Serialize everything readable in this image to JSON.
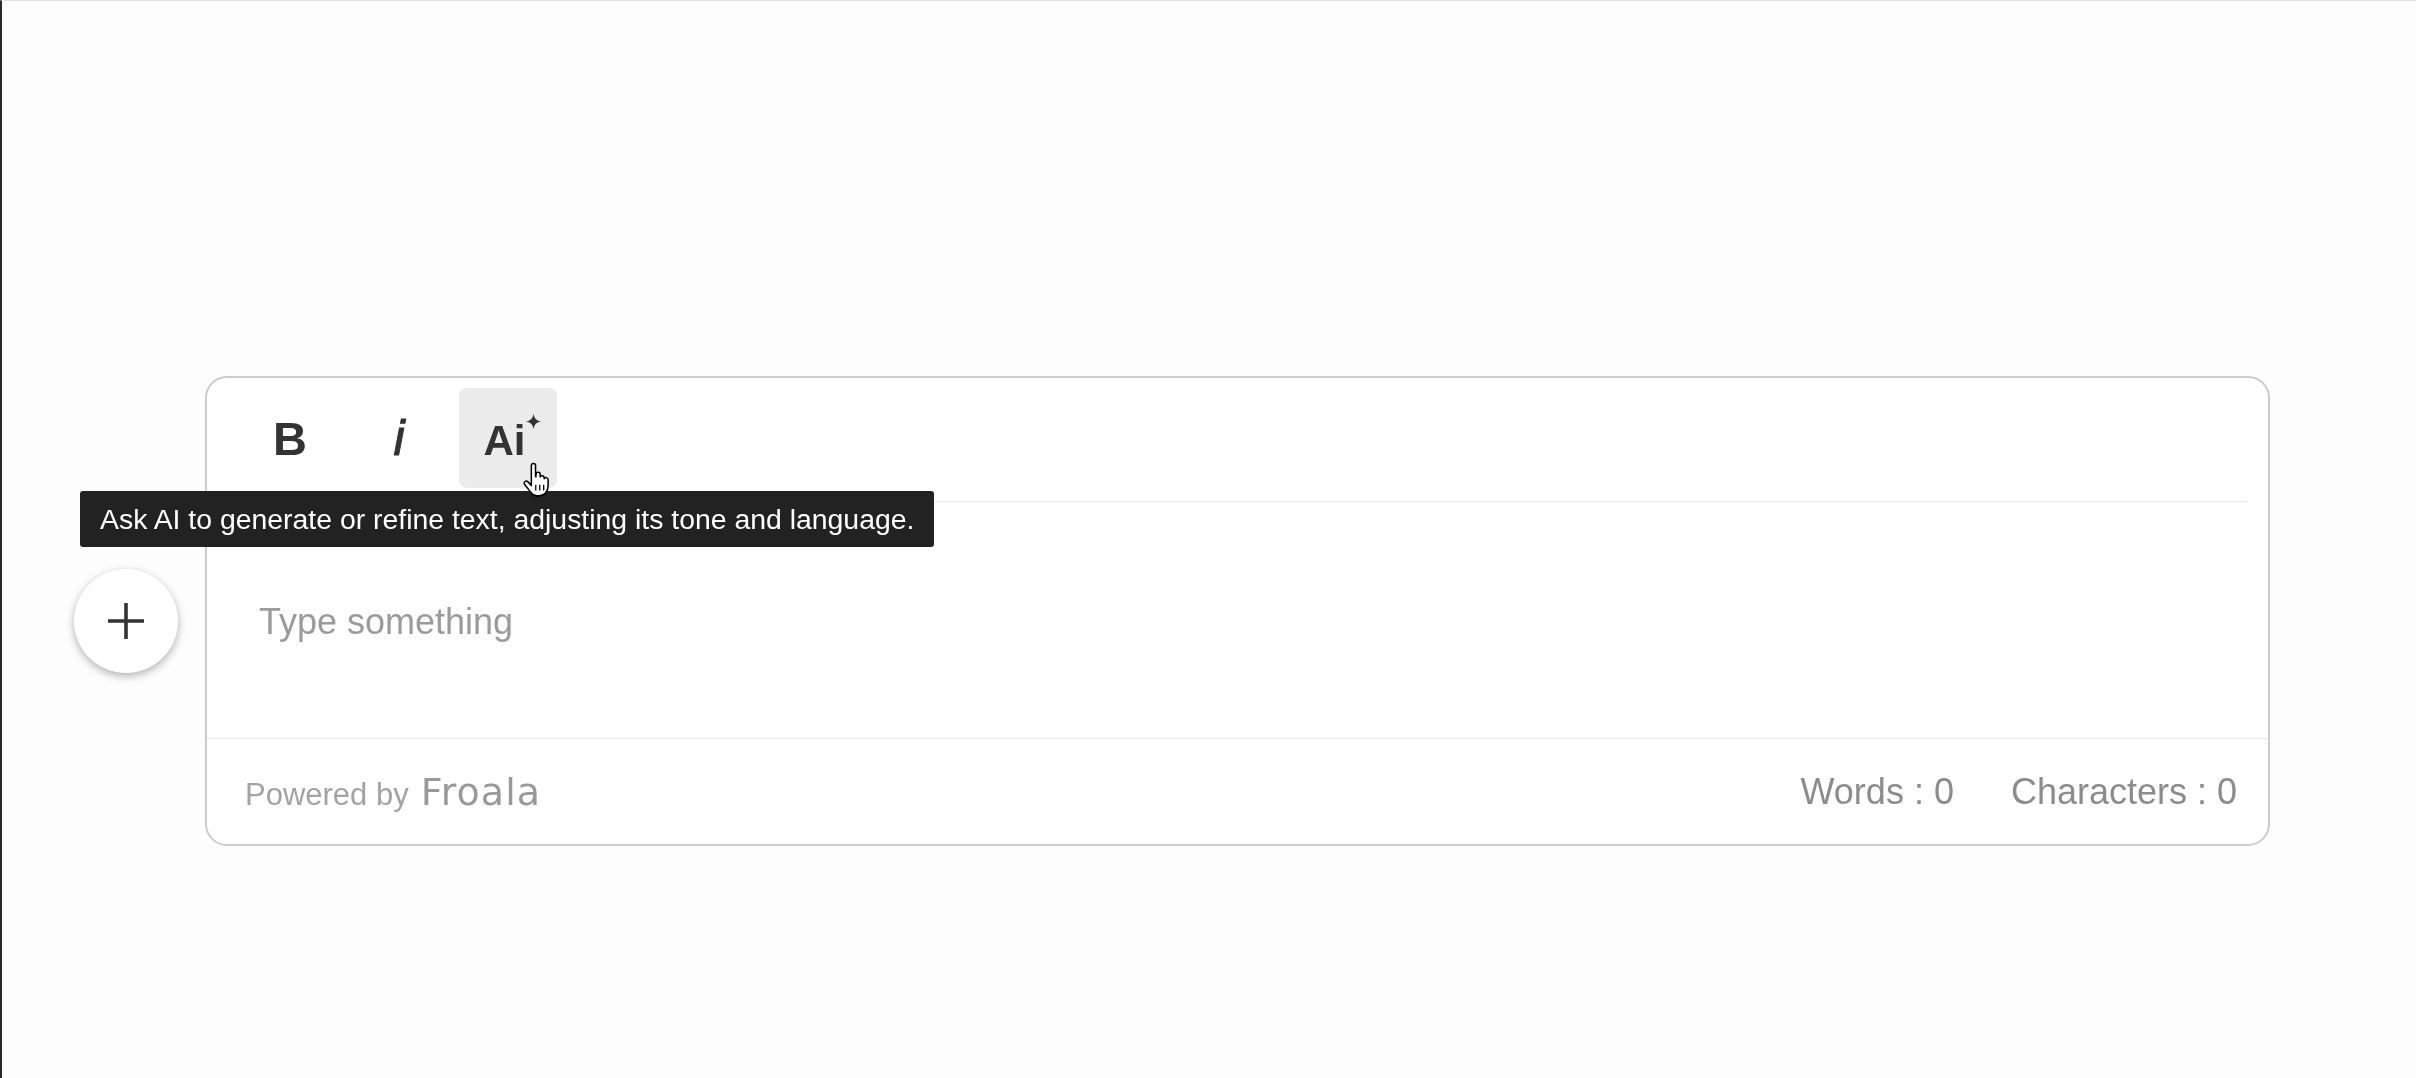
{
  "editor": {
    "toolbar": [
      {
        "kind": "bold",
        "label": "B",
        "hovered": false
      },
      {
        "kind": "italic",
        "label": "i",
        "hovered": false
      },
      {
        "kind": "ai",
        "label": "Ai",
        "hovered": true,
        "tooltip": "Ask AI to generate or refine text, adjusting its tone and language."
      }
    ],
    "placeholder": "Type something",
    "footer": {
      "powered_by": {
        "text": "Powered by",
        "logo": "Froala"
      },
      "counters": [
        {
          "label": "Words : 0"
        },
        {
          "label": "Characters : 0"
        }
      ]
    }
  }
}
